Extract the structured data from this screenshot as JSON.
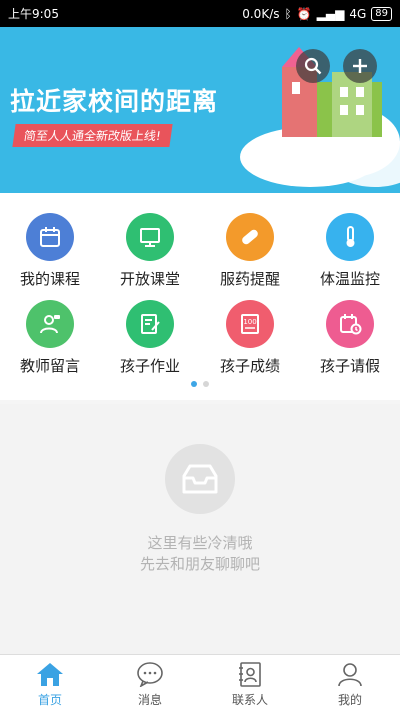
{
  "status_bar": {
    "time": "上午9:05",
    "speed": "0.0K/s",
    "network": "4G",
    "battery": "89"
  },
  "banner": {
    "title": "拉近家校间的距离",
    "subtitle": "简至人人通全新改版上线!"
  },
  "features": [
    {
      "label": "我的课程",
      "color": "#4d7fd6",
      "icon": "calendar-icon"
    },
    {
      "label": "开放课堂",
      "color": "#2fbf72",
      "icon": "classroom-icon"
    },
    {
      "label": "服药提醒",
      "color": "#f39a2b",
      "icon": "pill-icon"
    },
    {
      "label": "体温监控",
      "color": "#37b2ee",
      "icon": "thermometer-icon"
    },
    {
      "label": "教师留言",
      "color": "#4ec26b",
      "icon": "teacher-message-icon"
    },
    {
      "label": "孩子作业",
      "color": "#2fbf72",
      "icon": "homework-icon"
    },
    {
      "label": "孩子成绩",
      "color": "#f05d6e",
      "icon": "grades-icon"
    },
    {
      "label": "孩子请假",
      "color": "#ee5c91",
      "icon": "leave-icon"
    }
  ],
  "empty_state": {
    "line1": "这里有些冷清哦",
    "line2": "先去和朋友聊聊吧"
  },
  "tabs": [
    {
      "label": "首页",
      "icon": "home-icon"
    },
    {
      "label": "消息",
      "icon": "message-icon"
    },
    {
      "label": "联系人",
      "icon": "contacts-icon"
    },
    {
      "label": "我的",
      "icon": "profile-icon"
    }
  ],
  "colors": {
    "accent": "#3aa2e3",
    "banner_bg": "#39b8e5"
  }
}
